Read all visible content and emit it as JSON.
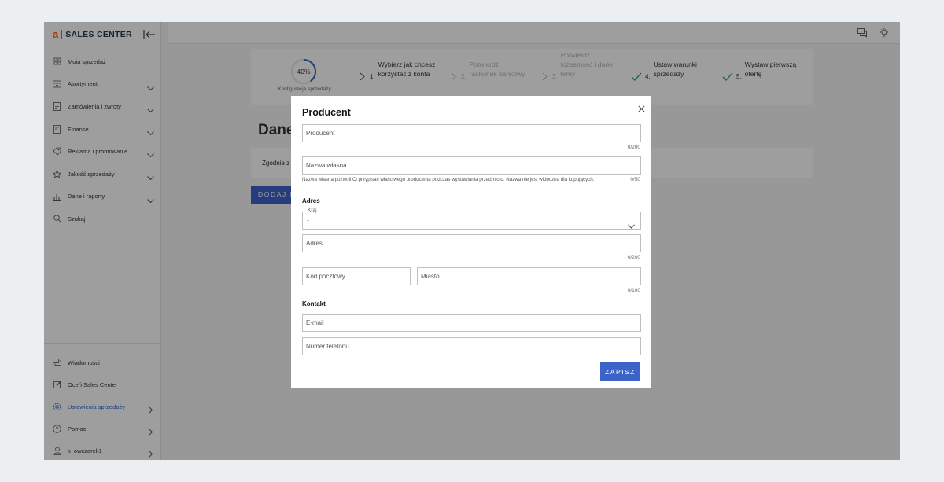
{
  "brand": {
    "logo_letter": "a",
    "name": "SALES CENTER"
  },
  "sidebar": {
    "items": [
      {
        "label": "Moja sprzedaż",
        "icon": "dashboard-icon",
        "has_chevron": false
      },
      {
        "label": "Asortyment",
        "icon": "box-icon",
        "has_chevron": true
      },
      {
        "label": "Zamówienia i zwroty",
        "icon": "document-icon",
        "has_chevron": true
      },
      {
        "label": "Finanse",
        "icon": "wallet-icon",
        "has_chevron": true
      },
      {
        "label": "Reklama i promowanie",
        "icon": "tag-icon",
        "has_chevron": true
      },
      {
        "label": "Jakość sprzedaży",
        "icon": "star-icon",
        "has_chevron": true
      },
      {
        "label": "Dane i raporty",
        "icon": "chart-icon",
        "has_chevron": true
      },
      {
        "label": "Szukaj",
        "icon": "search-icon",
        "has_chevron": false
      }
    ],
    "bottom_items": [
      {
        "label": "Wiadomości",
        "icon": "messages-icon"
      },
      {
        "label": "Oceń Sales Center",
        "icon": "edit-icon"
      },
      {
        "label": "Ustawienia sprzedaży",
        "icon": "gear-icon"
      },
      {
        "label": "Pomoc",
        "icon": "help-icon"
      },
      {
        "label": "k_owczarek1",
        "icon": "user-icon"
      }
    ]
  },
  "stepper": {
    "progress_percent": 40,
    "progress_text": "40%",
    "progress_label": "Konfiguracja sprzedaży",
    "steps": [
      {
        "num": "1.",
        "line1": "Wybierz jak chcesz",
        "line2": "korzystać z konta",
        "line3": "",
        "state": "current"
      },
      {
        "num": "2.",
        "line1": "Potwierdź",
        "line2": "rachunek bankowy",
        "line3": "",
        "state": "disabled"
      },
      {
        "num": "3.",
        "line1": "Potwierdź",
        "line2": "tożsamość i dane",
        "line3": "firmy",
        "state": "disabled"
      },
      {
        "num": "4.",
        "line1": "Ustaw warunki",
        "line2": "sprzedaży",
        "line3": "",
        "state": "done"
      },
      {
        "num": "5.",
        "line1": "Wystaw pierwszą",
        "line2": "ofertę",
        "line3": "",
        "state": "done"
      }
    ]
  },
  "page": {
    "heading_partial": "Dane",
    "info_partial": "Zgodnie z",
    "add_button_partial": "DODAJ P"
  },
  "modal": {
    "title": "Producent",
    "producer_placeholder": "Producent",
    "producer_counter": "0/200",
    "own_name_placeholder": "Nazwa własna",
    "own_name_hint": "Nazwa własna pozwoli Ci przypisać właściwego producenta podczas wystawiania przedmiotu. Nazwa nie jest widoczna dla kupujących.",
    "own_name_counter": "0/50",
    "address_section": "Adres",
    "country_label": "Kraj",
    "country_value": "-",
    "address_placeholder": "Adres",
    "address_counter": "0/200",
    "postal_placeholder": "Kod pocztowy",
    "city_placeholder": "Miasto",
    "city_counter": "0/100",
    "contact_section": "Kontakt",
    "email_placeholder": "E-mail",
    "phone_placeholder": "Numer telefonu",
    "save_label": "ZAPISZ"
  },
  "colors": {
    "accent": "#3c63c8",
    "brand": "#ff5a00",
    "done_check": "#2e9e5b",
    "active_link": "#2d6bcf"
  }
}
